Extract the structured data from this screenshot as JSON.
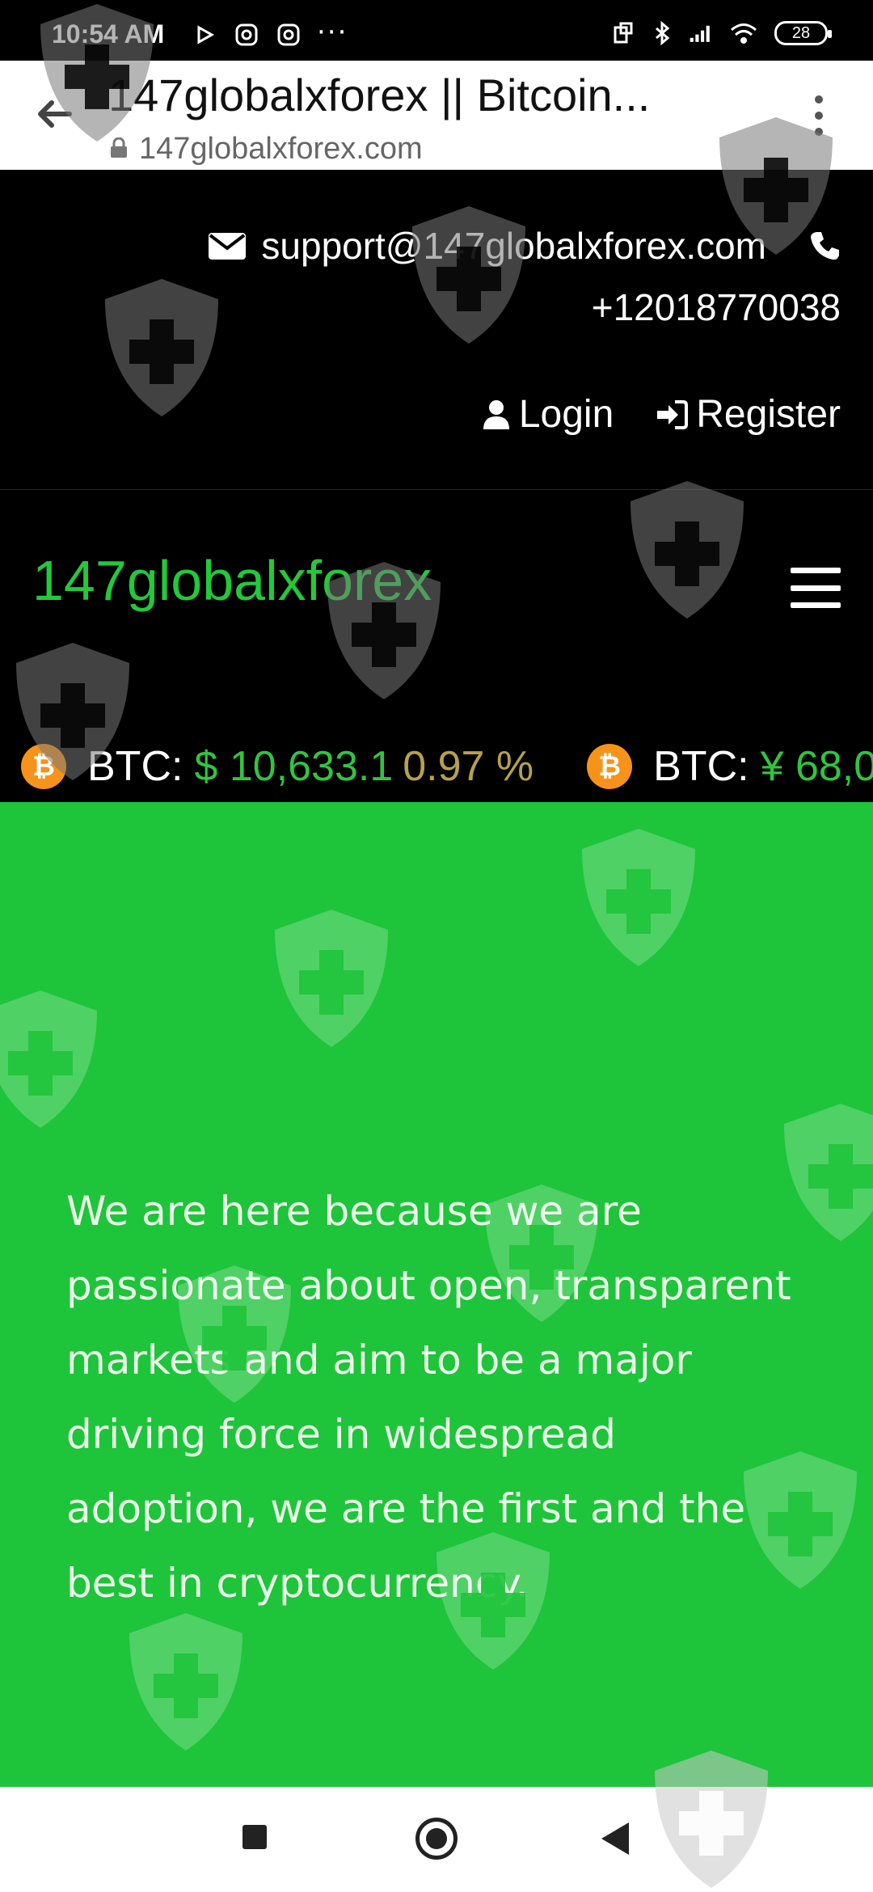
{
  "status_bar": {
    "time": "10:54 AM",
    "battery": "28",
    "overflow": "···"
  },
  "browser": {
    "page_title": "147globalxforex || Bitcoin...",
    "url": "147globalxforex.com"
  },
  "header": {
    "email": "support@147globalxforex.com",
    "phone": "+12018770038",
    "login_label": "Login",
    "register_label": "Register"
  },
  "brand": {
    "logo": "147globalxforex",
    "logo_color": "#22c93a"
  },
  "ticker": {
    "items": [
      {
        "coin_icon": "bitcoin-icon",
        "label": "BTC:",
        "price": "$ 10,633.1",
        "change": "0.97 %"
      },
      {
        "coin_icon": "bitcoin-icon",
        "label": "BTC:",
        "price": "¥ 68,0",
        "change": ""
      }
    ]
  },
  "hero": {
    "text": "We are here because we are passionate about open, transparent markets and aim to be a major driving force in widespread adoption, we are the first and the best in cryptocurrency.",
    "background": "#1ec43a"
  },
  "icons": {
    "back": "arrow-left-icon",
    "lock": "lock-icon",
    "menu": "kebab-menu-icon",
    "mail": "envelope-icon",
    "phone": "phone-icon",
    "user": "user-icon",
    "register": "sign-in-icon",
    "hamburger": "hamburger-icon",
    "watermark": "shield-plus-icon"
  }
}
